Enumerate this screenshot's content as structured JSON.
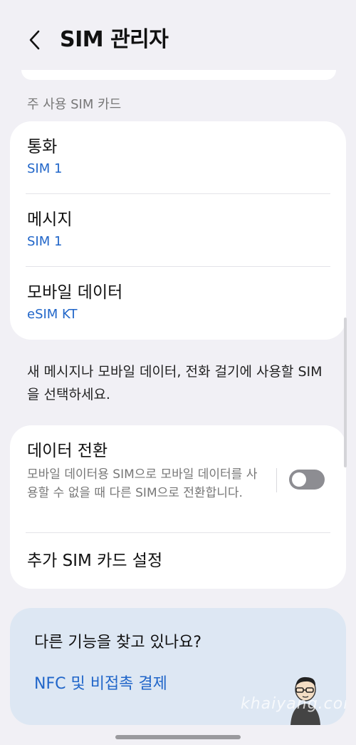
{
  "header": {
    "title": "SIM 관리자"
  },
  "section": {
    "label": "주 사용 SIM 카드"
  },
  "primary_sim": [
    {
      "title": "통화",
      "value": "SIM 1"
    },
    {
      "title": "메시지",
      "value": "SIM 1"
    },
    {
      "title": "모바일 데이터",
      "value": "eSIM KT"
    }
  ],
  "description": "새 메시지나 모바일 데이터, 전화 걸기에 사용할 SIM을 선택하세요.",
  "data_switch": {
    "title": "데이터 전환",
    "description": "모바일 데이터용 SIM으로 모바일 데이터를 사용할 수 없을 때 다른 SIM으로 전환합니다.",
    "enabled": false
  },
  "more_settings": {
    "label": "추가 SIM 카드 설정"
  },
  "suggestions": {
    "title": "다른 기능을 찾고 있나요?",
    "link": "NFC 및 비접촉 결제"
  },
  "watermark": "khaiyang.com",
  "colors": {
    "background": "#f1f0f5",
    "accent": "#2166c9",
    "suggest_bg": "#dde7f3",
    "toggle_off": "#8d8d92"
  },
  "icons": {
    "back": "chevron-left-icon"
  }
}
